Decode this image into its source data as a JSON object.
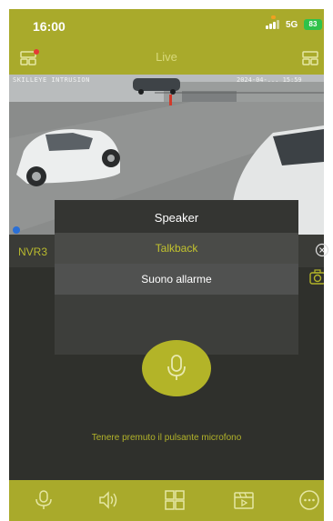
{
  "status_bar": {
    "time": "16:00",
    "network": "5G",
    "battery": "83"
  },
  "header": {
    "title": "Live"
  },
  "camera": {
    "osd_text": "SKILLEYE INTRUSION",
    "osd_time": "2024-04-... 15:59"
  },
  "channel": {
    "name": "NVR3"
  },
  "popup": {
    "title": "Speaker",
    "items": [
      "Talkback",
      "Suono allarme"
    ]
  },
  "hint": "Tenere premuto il pulsante microfono",
  "icons": {
    "device_list": "device-list-icon",
    "header_right": "header-grid-icon",
    "close": "close-circle-icon",
    "snapshot": "camera-snapshot-icon",
    "mic": "microphone-icon",
    "toolbar": [
      "microphone-icon",
      "speaker-icon",
      "grid-icon",
      "playback-icon",
      "more-icon"
    ]
  },
  "colors": {
    "accent": "#a9aa2b",
    "background": "#2f302c",
    "highlight_text": "#c2c32e",
    "recording_dot": "#2a6fd6",
    "status_dot": "#e53935"
  }
}
